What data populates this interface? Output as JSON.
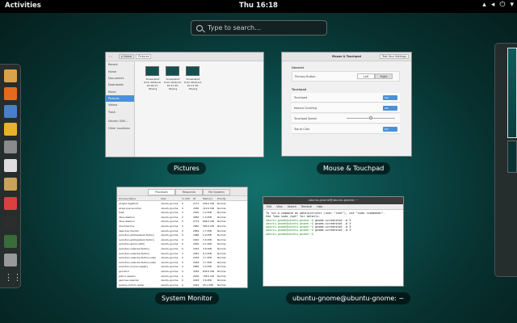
{
  "topbar": {
    "activities": "Activities",
    "clock": "Thu 16:18"
  },
  "search": {
    "placeholder": "Type to search…"
  },
  "dash": {
    "apps": [
      {
        "name": "user-icon",
        "color": "#d9a34a"
      },
      {
        "name": "firefox-icon",
        "color": "#e66a1c"
      },
      {
        "name": "thunderbird-icon",
        "color": "#4a7fc9"
      },
      {
        "name": "rhythmbox-icon",
        "color": "#e8b32a"
      },
      {
        "name": "files-icon",
        "color": "#8a8a8a"
      },
      {
        "name": "writer-icon",
        "color": "#dedede"
      },
      {
        "name": "software-icon",
        "color": "#c9a25a"
      },
      {
        "name": "help-icon",
        "color": "#d94040"
      },
      {
        "name": "terminal-icon",
        "color": "#2d2d2d"
      },
      {
        "name": "system-monitor-icon",
        "color": "#3a6b3a"
      },
      {
        "name": "tweak-tool-icon",
        "color": "#999"
      },
      {
        "name": "show-apps-icon",
        "color": "#ccc"
      }
    ]
  },
  "windows": {
    "pictures": {
      "caption": "Pictures",
      "header": "Pictures",
      "sidebar": [
        "Recent",
        "Home",
        "Documents",
        "Downloads",
        "Music",
        "Pictures",
        "Videos",
        "Trash",
        "Ubuntu GNO…",
        "Other Locations"
      ],
      "files": [
        "Screenshot from 2016-10-20 16-17-36.png",
        "Screenshot from 2016-10-20 17-35-09.png",
        "Screenshot from 2016-10-20 17-35-09.png"
      ]
    },
    "mouse": {
      "caption": "Mouse & Touchpad",
      "title": "Mouse & Touchpad",
      "test_button": "Test Your Settings",
      "general": "General",
      "primary_button": "Primary Button",
      "left": "Left",
      "right": "Right",
      "touchpad": "Touchpad",
      "rows": [
        "Touchpad",
        "Natural Scrolling",
        "Touchpad Speed",
        "Tap to Click"
      ],
      "on": "ON"
    },
    "sysmon": {
      "caption": "System Monitor",
      "tabs": [
        "Processes",
        "Resources",
        "File Systems"
      ],
      "columns": [
        "Process Name",
        "User",
        "% CPU",
        "ID",
        "Memory",
        "Priority"
      ],
      "rows": [
        [
          "at-spi2-registryd",
          "ubuntu-gnome",
          "0",
          "2777",
          "936.0 KiB",
          "Normal"
        ],
        [
          "at-spi-bus-launcher",
          "ubuntu-gnome",
          "0",
          "2280",
          "312.0 KiB",
          "Normal"
        ],
        [
          "bash",
          "ubuntu-gnome",
          "0",
          "2926",
          "1.4 MiB",
          "Normal"
        ],
        [
          "dbus-daemon",
          "ubuntu-gnome",
          "0",
          "2860",
          "1.4 MiB",
          "Normal"
        ],
        [
          "dbus-daemon",
          "ubuntu-gnome",
          "0",
          "2774",
          "808.0 KiB",
          "Normal"
        ],
        [
          "dconf-service",
          "ubuntu-gnome",
          "0",
          "2850",
          "500.0 KiB",
          "Normal"
        ],
        [
          "deja-dup-monitor",
          "ubuntu-gnome",
          "0",
          "2864",
          "1.7 MiB",
          "Normal"
        ],
        [
          "evolution-addressbook-factory",
          "ubuntu-gnome",
          "0",
          "2986",
          "2.9 MiB",
          "Normal"
        ],
        [
          "evolution-addressbook-factory",
          "ubuntu-gnome",
          "0",
          "2910",
          "3.6 MiB",
          "Normal"
        ],
        [
          "evolution-alarm-notify",
          "ubuntu-gnome",
          "0",
          "2900",
          "9.1 MiB",
          "Normal"
        ],
        [
          "evolution-calendar-factory",
          "ubuntu-gnome",
          "0",
          "2919",
          "3.6 MiB",
          "Normal"
        ],
        [
          "evolution-calendar-factory",
          "ubuntu-gnome",
          "0",
          "2925",
          "8.3 MiB",
          "Normal"
        ],
        [
          "evolution-calendar-factory-subp",
          "ubuntu-gnome",
          "0",
          "2936",
          "3.7 MiB",
          "Normal"
        ],
        [
          "evolution-calendar-factory-subp",
          "ubuntu-gnome",
          "0",
          "2948",
          "3.7 MiB",
          "Normal"
        ],
        [
          "evolution-source-registry",
          "ubuntu-gnome",
          "0",
          "2885",
          "3.4 MiB",
          "Normal"
        ],
        [
          "gconfd-2",
          "ubuntu-gnome",
          "0",
          "3264",
          "836.0 KiB",
          "Normal"
        ],
        [
          "gdm-x-session",
          "ubuntu-gnome",
          "0",
          "2650",
          "796.0 KiB",
          "Normal"
        ],
        [
          "geoclue-calendar",
          "ubuntu-gnome",
          "0",
          "2918",
          "3.6 MiB",
          "Normal"
        ],
        [
          "gnome-control-center",
          "ubuntu-gnome",
          "0",
          "2924",
          "25.1 MiB",
          "Normal"
        ]
      ]
    },
    "terminal": {
      "caption": "ubuntu-gnome@ubuntu-gnome: ~",
      "title": "ubuntu-gnome@ubuntu-gnome: ~",
      "menu": [
        "Edit",
        "View",
        "Search",
        "Terminal",
        "Help"
      ],
      "lines": [
        "To run a command as administrator (user \"root\"), use \"sudo <command>\".",
        "See \"man sudo_root\" for details."
      ],
      "prompt": "ubuntu-gnome@ubuntu-gnome:~$",
      "command": "gnome-screenshot -d 3",
      "repeat": 4
    }
  }
}
